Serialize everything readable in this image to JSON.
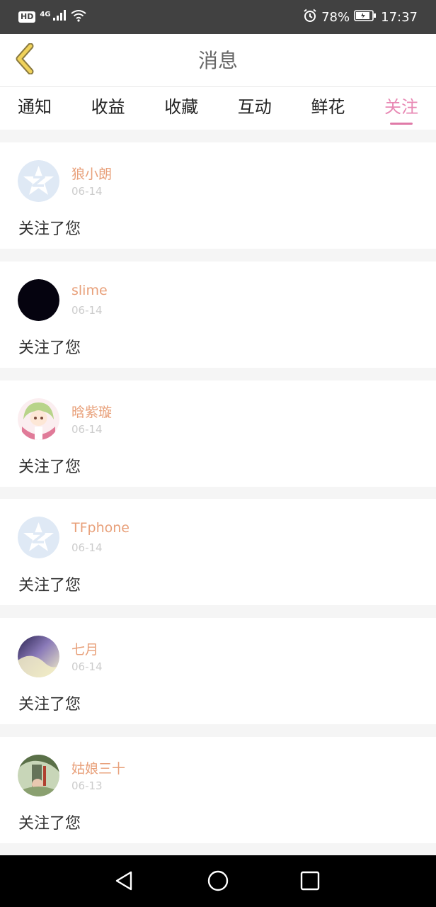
{
  "status_bar": {
    "hd": "HD",
    "network": "4G",
    "battery": "78%",
    "time": "17:37",
    "icons": [
      "signal-icon",
      "wifi-icon",
      "alarm-icon",
      "battery-icon"
    ]
  },
  "header": {
    "title": "消息",
    "back_icon": "chevron-left-icon"
  },
  "tabs": [
    {
      "label": "通知",
      "active": false
    },
    {
      "label": "收益",
      "active": false
    },
    {
      "label": "收藏",
      "active": false
    },
    {
      "label": "互动",
      "active": false
    },
    {
      "label": "鲜花",
      "active": false
    },
    {
      "label": "关注",
      "active": true
    }
  ],
  "messages": [
    {
      "name": "狼小朗",
      "date": "06-14",
      "text": "关注了您",
      "avatar": "default-star-avatar"
    },
    {
      "name": "slime",
      "date": "06-14",
      "text": "关注了您",
      "avatar": "dark-avatar"
    },
    {
      "name": "晗紫璇",
      "date": "06-14",
      "text": "关注了您",
      "avatar": "anime-avatar"
    },
    {
      "name": "TFphone",
      "date": "06-14",
      "text": "关注了您",
      "avatar": "default-star-avatar"
    },
    {
      "name": "七月",
      "date": "06-14",
      "text": "关注了您",
      "avatar": "photo-avatar"
    },
    {
      "name": "姑娘三十",
      "date": "06-13",
      "text": "关注了您",
      "avatar": "book-cover-avatar"
    }
  ],
  "nav_bar": {
    "icons": [
      "back-triangle-icon",
      "home-circle-icon",
      "recents-square-icon"
    ]
  },
  "colors": {
    "accent": "#e889b4",
    "username": "#e8a07a",
    "status_bar": "#414141",
    "back_chevron": "#e6c64a"
  }
}
